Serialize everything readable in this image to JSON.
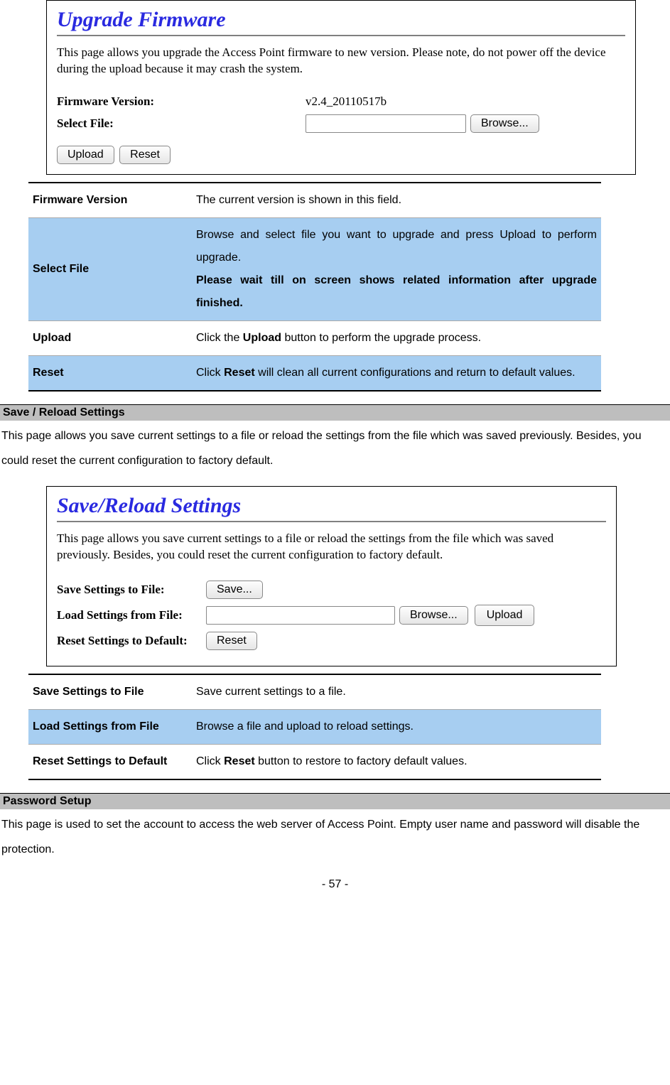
{
  "panel1": {
    "title": "Upgrade Firmware",
    "description": "This page allows you upgrade the Access Point firmware to new version. Please note, do not power off the device during the upload because it may crash the system.",
    "firmware_label": "Firmware Version:",
    "firmware_value": "v2.4_20110517b",
    "selectfile_label": "Select File:",
    "browse_btn": "Browse...",
    "upload_btn": "Upload",
    "reset_btn": "Reset"
  },
  "table1": {
    "rows": [
      {
        "label": "Firmware Version",
        "desc": "The current version is shown in this field."
      },
      {
        "label": "Select File",
        "desc_pre": "Browse and select file you want to upgrade and press Upload to perform upgrade.",
        "desc_bold": "Please wait till on screen shows related information after upgrade finished."
      },
      {
        "label": "Upload",
        "desc_pre": "Click the ",
        "desc_bold": "Upload",
        "desc_post": " button to perform the upgrade process."
      },
      {
        "label": "Reset",
        "desc_pre": "Click ",
        "desc_bold": "Reset",
        "desc_post": " will clean all current configurations and return to default values."
      }
    ]
  },
  "section1": {
    "heading": "Save / Reload Settings",
    "text": "This page allows you save current settings to a file or reload the settings from the file which was saved previously. Besides, you could reset the current configuration to factory default."
  },
  "panel2": {
    "title": "Save/Reload Settings",
    "description": "This page allows you save current settings to a file or reload the settings from the file which was saved previously. Besides, you could reset the current configuration to factory default.",
    "save_label": "Save Settings to File:",
    "save_btn": "Save...",
    "load_label": "Load Settings from File:",
    "browse_btn": "Browse...",
    "upload_btn": "Upload",
    "reset_label": "Reset Settings to Default:",
    "reset_btn": "Reset"
  },
  "table2": {
    "rows": [
      {
        "label": "Save Settings to File",
        "desc": "Save current settings to a file."
      },
      {
        "label": "Load Settings from File",
        "desc": "Browse a file and upload to reload settings."
      },
      {
        "label": "Reset Settings to Default",
        "desc_pre": "Click ",
        "desc_bold": "Reset",
        "desc_post": " button to restore to factory default values."
      }
    ]
  },
  "section2": {
    "heading": "Password Setup",
    "text": "This page is used to set the account to access the web server of Access Point. Empty user name and password will disable the protection."
  },
  "page_number": "- 57 -"
}
